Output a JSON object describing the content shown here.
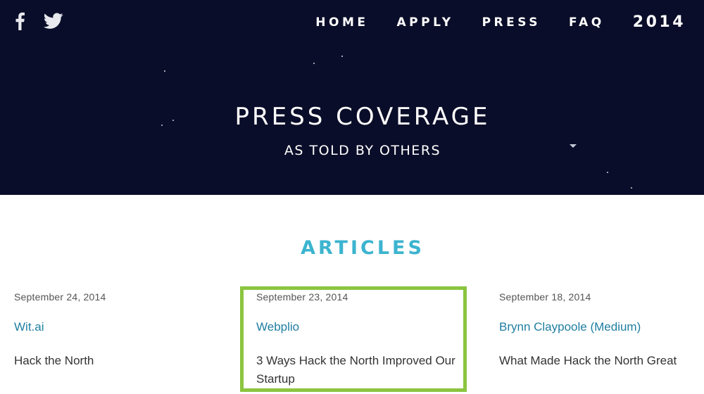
{
  "social": {
    "facebook_icon": "facebook-icon",
    "twitter_icon": "twitter-icon"
  },
  "nav": {
    "items": [
      "HOME",
      "APPLY",
      "PRESS",
      "FAQ"
    ],
    "year": "2014"
  },
  "hero": {
    "title": "PRESS COVERAGE",
    "subtitle": "AS TOLD BY OTHERS"
  },
  "articles_section": {
    "title": "ARTICLES",
    "items": [
      {
        "date": "September 24, 2014",
        "source": "Wit.ai",
        "headline": "Hack the North"
      },
      {
        "date": "September 23, 2014",
        "source": "Webplio",
        "headline": "3 Ways Hack the North Improved Our Startup"
      },
      {
        "date": "September 18, 2014",
        "source": "Brynn Claypoole (Medium)",
        "headline": "What Made Hack the North Great"
      }
    ]
  },
  "colors": {
    "hero_background": "#0a0d29",
    "section_title": "#3cb4cf",
    "link": "#1f7ea0",
    "highlight_border": "#8bc53f"
  }
}
